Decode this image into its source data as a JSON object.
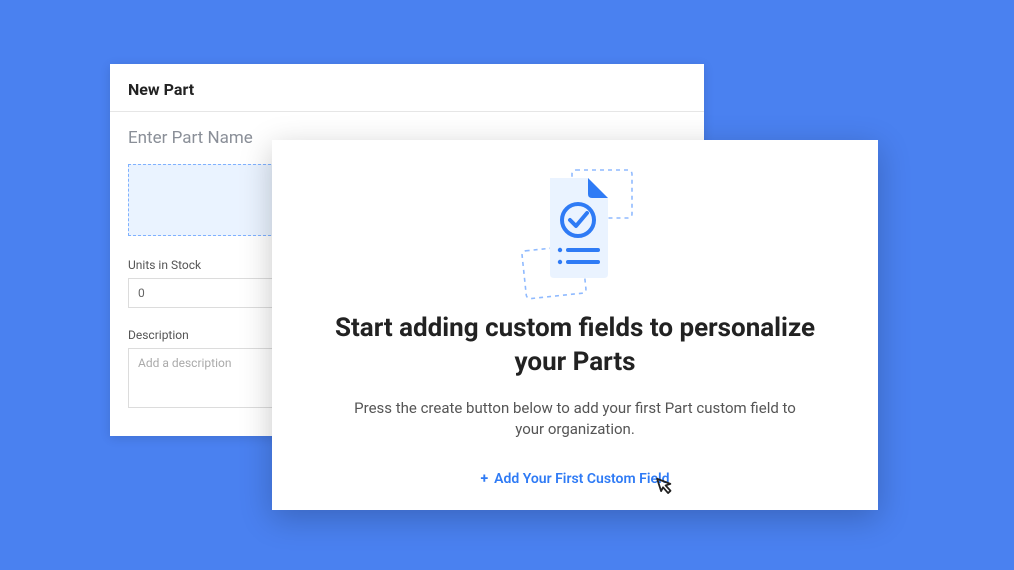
{
  "back": {
    "title": "New Part",
    "partNameLabel": "Enter Part Name",
    "unitsLabel": "Units in Stock",
    "unitsValue": "0",
    "descLabel": "Description",
    "descPlaceholder": "Add a description"
  },
  "front": {
    "heading": "Start adding custom fields to personalize your Parts",
    "sub": "Press the create button below to add your first Part custom field to your organization.",
    "plus": "+",
    "addLabel": "Add Your First Custom Field"
  }
}
